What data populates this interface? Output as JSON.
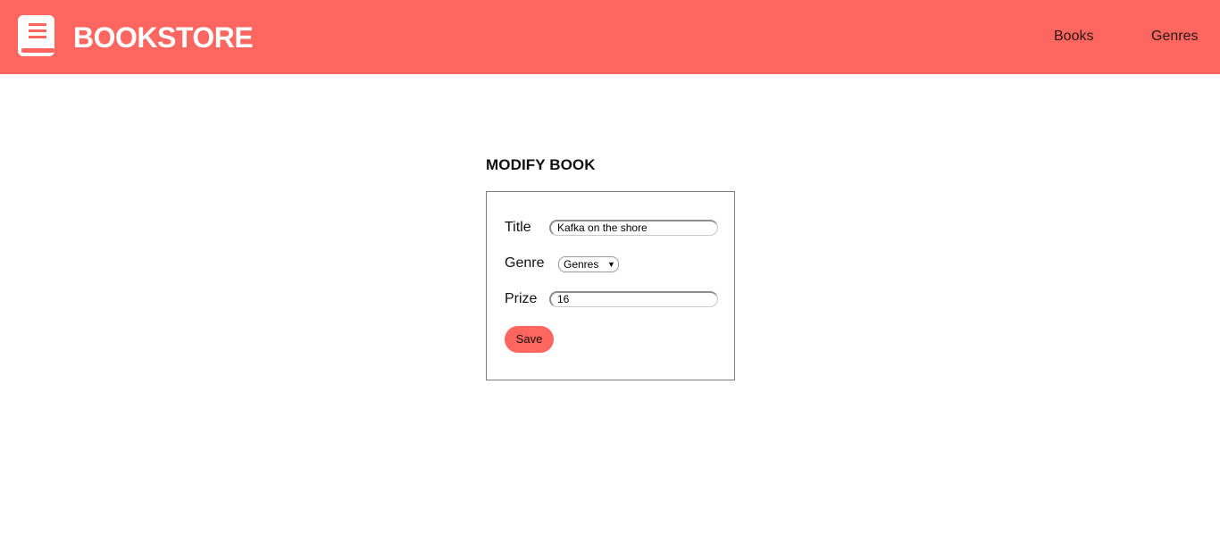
{
  "header": {
    "brand": "BOOKSTORE",
    "logo_icon": "book-icon",
    "nav": [
      {
        "label": "Books"
      },
      {
        "label": "Genres"
      }
    ],
    "colors": {
      "accent": "#ff6660"
    }
  },
  "main": {
    "title": "MODIFY BOOK",
    "form": {
      "title_label": "Title",
      "title_value": "Kafka on the shore",
      "genre_label": "Genre",
      "genre_selected": "Genres",
      "genre_arrow_icon": "dropdown-arrow-icon",
      "prize_label": "Prize",
      "prize_value": "16",
      "save_label": "Save"
    }
  }
}
